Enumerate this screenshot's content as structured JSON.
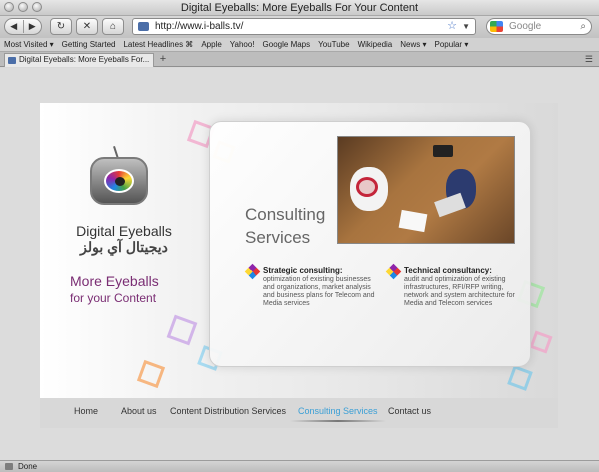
{
  "window": {
    "title": "Digital Eyeballs: More Eyeballs For Your Content"
  },
  "toolbar": {
    "back_icon": "back-arrow-icon",
    "forward_icon": "forward-arrow-icon",
    "reload_icon": "reload-icon",
    "stop_icon": "stop-icon",
    "home_icon": "home-icon",
    "url": "http://www.i-balls.tv/",
    "search_placeholder": "Google"
  },
  "bookmarks": [
    "Most Visited ▾",
    "Getting Started",
    "Latest Headlines ⌘",
    "Apple",
    "Yahoo!",
    "Google Maps",
    "YouTube",
    "Wikipedia",
    "News ▾",
    "Popular ▾"
  ],
  "tab": {
    "label": "Digital Eyeballs: More Eyeballs For...",
    "new_tab": "+"
  },
  "site": {
    "brand_name": "Digital Eyeballs",
    "brand_arabic": "ديجيتال آي بولز",
    "tagline_line1": "More Eyeballs",
    "tagline_line2": "for your Content",
    "heading_line1": "Consulting",
    "heading_line2": "Services",
    "services": [
      {
        "title": "Strategic consulting:",
        "description": "optimization of existing businesses and organizations, market analysis and business plans for Telecom and Media services"
      },
      {
        "title": "Technical consultancy:",
        "description": "audit and optimization of existing infrastructures, RFI/RFP writing, network and system architecture for Media and Telecom services"
      }
    ],
    "nav": [
      "Home",
      "About us",
      "Content Distribution Services",
      "Consulting Services",
      "Contact us"
    ],
    "active_nav": "Consulting Services"
  },
  "status": {
    "text": "Done"
  },
  "colors": {
    "accent_purple": "#7a2d73",
    "nav_active": "#3a9fd6"
  }
}
